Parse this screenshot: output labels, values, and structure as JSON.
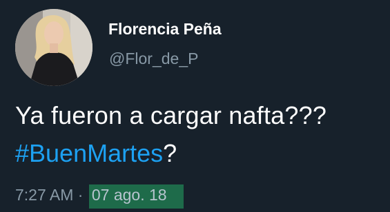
{
  "tweet": {
    "author_name": "Florencia Peña",
    "author_handle": "@Flor_de_P",
    "text_line1": "Ya fueron a cargar nafta???",
    "hashtag": "#BuenMartes",
    "text_line2_suffix": "?",
    "time": "7:27 AM",
    "separator": " · ",
    "date": "07 ago. 18"
  },
  "colors": {
    "background": "#17212b",
    "name": "#ffffff",
    "handle": "#8899a6",
    "hashtag": "#1da1f2",
    "date_highlight": "#1e6b4a"
  }
}
